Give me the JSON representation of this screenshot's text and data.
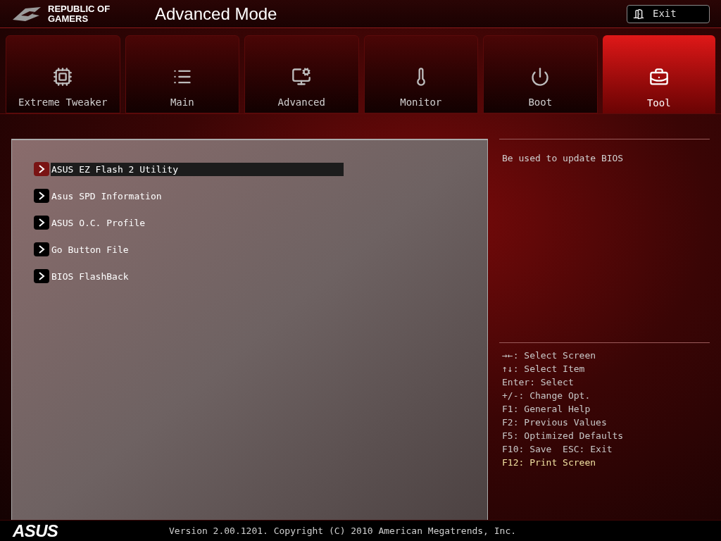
{
  "header": {
    "brand": "REPUBLIC OF GAMERS",
    "title": "Advanced Mode",
    "exit_button": "Exit"
  },
  "tabs": [
    {
      "label": "Extreme Tweaker",
      "selected": false
    },
    {
      "label": "Main",
      "selected": false
    },
    {
      "label": "Advanced",
      "selected": false
    },
    {
      "label": "Monitor",
      "selected": false
    },
    {
      "label": "Boot",
      "selected": false
    },
    {
      "label": "Tool",
      "selected": true
    }
  ],
  "menu_items": [
    {
      "label": "ASUS EZ Flash 2 Utility",
      "selected": true
    },
    {
      "label": "Asus SPD Information",
      "selected": false
    },
    {
      "label": "ASUS O.C. Profile",
      "selected": false
    },
    {
      "label": "Go Button File",
      "selected": false
    },
    {
      "label": "BIOS FlashBack",
      "selected": false
    }
  ],
  "help_text": "Be used to update BIOS",
  "key_hints": [
    {
      "text": "→←: Select Screen",
      "highlighted": false
    },
    {
      "text": "↑↓: Select Item",
      "highlighted": false
    },
    {
      "text": "Enter: Select",
      "highlighted": false
    },
    {
      "text": "+/-: Change Opt.",
      "highlighted": false
    },
    {
      "text": "F1: General Help",
      "highlighted": false
    },
    {
      "text": "F2: Previous Values",
      "highlighted": false
    },
    {
      "text": "F5: Optimized Defaults",
      "highlighted": false
    },
    {
      "text": "F10: Save  ESC: Exit",
      "highlighted": false
    },
    {
      "text": "F12: Print Screen",
      "highlighted": true
    }
  ],
  "footer": {
    "brand": "ASUS",
    "version": "Version 2.00.1201. Copyright (C) 2010 American Megatrends, Inc."
  }
}
